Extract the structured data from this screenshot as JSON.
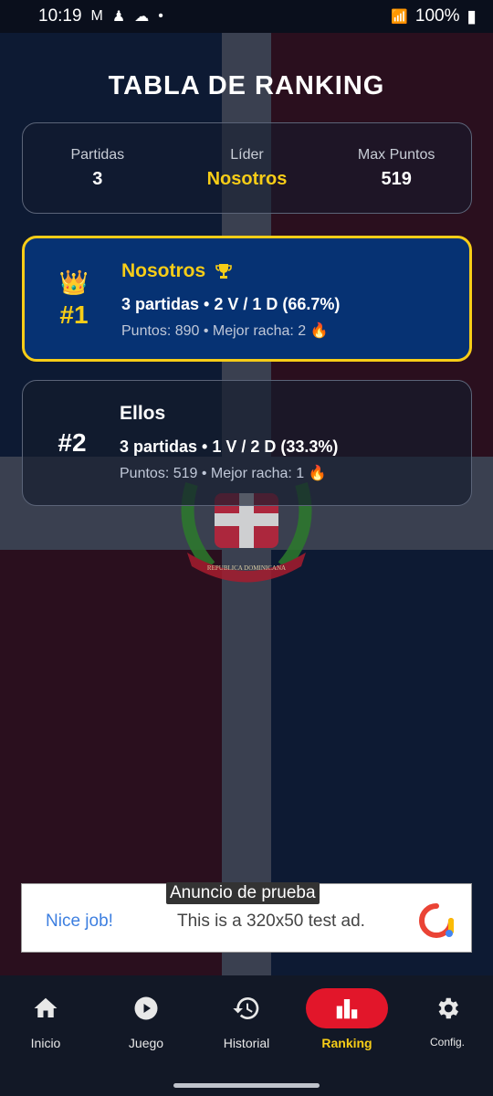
{
  "status_bar": {
    "time": "10:19",
    "battery": "100%"
  },
  "title": "TABLA DE RANKING",
  "summary": {
    "games_label": "Partidas",
    "games_value": "3",
    "leader_label": "Líder",
    "leader_value": "Nosotros",
    "max_label": "Max Puntos",
    "max_value": "519"
  },
  "ranking": [
    {
      "rank": "#1",
      "name": "Nosotros",
      "stats": "3 partidas • 2 V / 1 D (66.7%)",
      "points": "Puntos: 890 • Mejor racha: 2 🔥"
    },
    {
      "rank": "#2",
      "name": "Ellos",
      "stats": "3 partidas • 1 V / 2 D (33.3%)",
      "points": "Puntos: 519 • Mejor racha: 1 🔥"
    }
  ],
  "ad": {
    "label": "Anuncio de prueba",
    "headline": "Nice job!",
    "text": "This is a 320x50 test ad."
  },
  "emblem": {
    "ribbon": "REPUBLICA DOMINICANA"
  },
  "nav": [
    {
      "label": "Inicio",
      "icon": "home-icon"
    },
    {
      "label": "Juego",
      "icon": "play-icon"
    },
    {
      "label": "Historial",
      "icon": "history-icon"
    },
    {
      "label": "Ranking",
      "icon": "bar-chart-icon",
      "active": true
    },
    {
      "label": "Config.",
      "icon": "gear-icon"
    }
  ],
  "colors": {
    "gold": "#f7cd17",
    "red": "#e2162a",
    "blue": "#063273"
  }
}
